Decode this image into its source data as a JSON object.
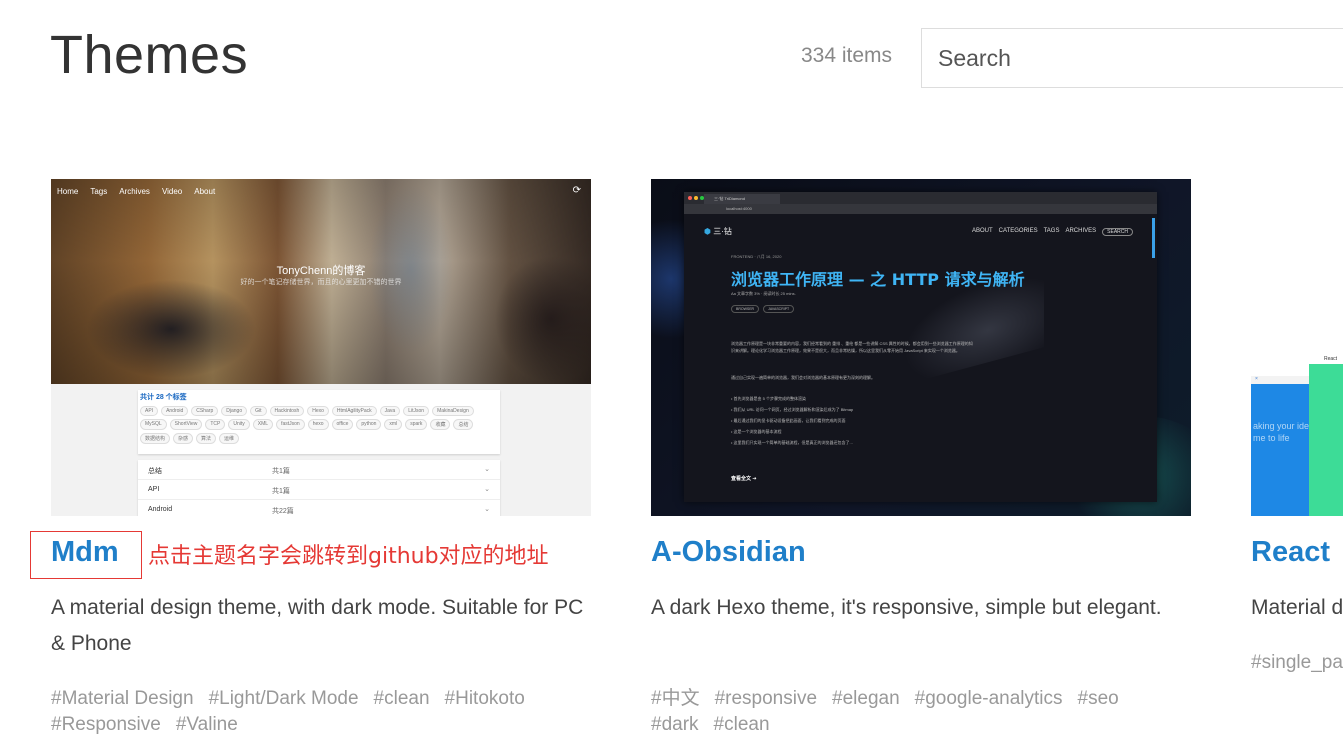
{
  "header": {
    "title": "Themes",
    "item_count": "334 items",
    "search_placeholder": "Search"
  },
  "annotation": {
    "text": "点击主题名字会跳转到github对应的地址",
    "color": "#e53935"
  },
  "cards": [
    {
      "name": "Mdm",
      "description": "A material design theme, with dark mode. Suitable for PC & Phone",
      "tags": [
        "#Material Design",
        "#Light/Dark Mode",
        "#clean",
        "#Hitokoto",
        "#Responsive",
        "#Valine"
      ],
      "thumbnail": {
        "nav": [
          "Home",
          "Tags",
          "Archives",
          "Video",
          "About"
        ],
        "blog_title": "TonyChenn的博客",
        "blog_subtitle": "好的一个笔记存储世界，而且的心里更加不错的世界",
        "tag_panel_title": "共计 28 个标签",
        "chips": [
          "API",
          "Android",
          "CSharp",
          "Django",
          "Git",
          "Hackintosh",
          "Hexo",
          "HtmlAgilityPack",
          "Java",
          "LitJson",
          "MakinaDesign",
          "MySQL",
          "ShortView",
          "TCP",
          "Unity",
          "XML",
          "fastJson",
          "hexo",
          "office",
          "python",
          "xml",
          "spark",
          "收藏",
          "总结",
          "数据结构",
          "杂感",
          "算法",
          "运维"
        ],
        "rows": [
          {
            "name": "总结",
            "count": "共1篇"
          },
          {
            "name": "API",
            "count": "共1篇"
          },
          {
            "name": "Android",
            "count": "共22篇"
          }
        ]
      }
    },
    {
      "name": "A-Obsidian",
      "description": "A dark Hexo theme, it's responsive, simple but elegant.",
      "tags": [
        "#中文",
        "#responsive",
        "#elegan",
        "#google-analytics",
        "#seo",
        "#dark",
        "#clean"
      ],
      "thumbnail": {
        "tab_title": "三·钻 TriDiamond",
        "url": "localhost:4000",
        "logo": "三·钻",
        "nav": [
          "ABOUT",
          "CATEGORIES",
          "TAGS",
          "ARCHIVES",
          "SEARCH"
        ],
        "post_meta": "FRONTEND · 八月 16, 2020",
        "headline": "浏览器工作原理 — 之 HTTP 请求与解析",
        "post_stats": "Aa 文章字数 3% · 阅读时长 25 mins.",
        "chips": [
          "BROWSER",
          "JAVASCRIPT"
        ],
        "paragraph_1": "浏览器工作原理是一块非常重要的内容，我们经常看到的 重排 、重绘 都是一些讲解 CSS 属性的时候，都会用到一些浏览器工作原理的知识来讲解。理论化学习浏览器工作原理，效果不是很大，而且非常枯燥，所以这里我们从零开始用 JavaScript 来实现一个浏览器。",
        "paragraph_2": "通过自己实现一遍简单的浏览器，我们会对浏览器的基本原理有更为深刻的理解。",
        "bullets": [
          "首先浏览器是由 5 个步骤完成的整体渲染",
          "我们从 URL 访问一个网页，经过浏览器解析和渲染后成为了 Bitmap",
          "最后通过我们的显卡驱动设备把此画面，让我们看到完成的页面",
          "这是一个浏览器的基本流程",
          "这里我们只实现一个简单的基础流程，但是真正的浏览器还包含了..."
        ],
        "read_more": "查看全文 ➔"
      }
    },
    {
      "name": "React",
      "description": "Material d",
      "tags": [
        "#single_pa"
      ],
      "thumbnail": {
        "blue_text": "aking your ide\nme to life",
        "green_label": "React",
        "bar_close": "×"
      }
    }
  ]
}
